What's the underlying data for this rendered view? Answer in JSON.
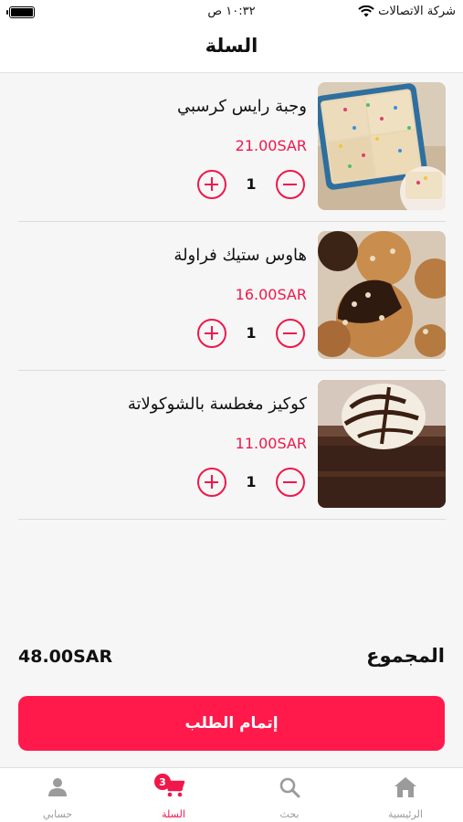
{
  "status_bar": {
    "time": "١٠:٣٢ ص",
    "carrier": "شركة الاتصالات"
  },
  "header": {
    "title": "السلة"
  },
  "cart": {
    "items": [
      {
        "name": "وجبة رايس كرسبي",
        "price": "21.00SAR",
        "quantity": "1"
      },
      {
        "name": "هاوس ستيك  فراولة",
        "price": "16.00SAR",
        "quantity": "1"
      },
      {
        "name": "كوكيز مغطسة بالشوكولاتة",
        "price": "11.00SAR",
        "quantity": "1"
      }
    ]
  },
  "summary": {
    "total_label": "المجموع",
    "total_value": "48.00SAR"
  },
  "checkout": {
    "label": "إتمام الطلب"
  },
  "tab_bar": {
    "tabs": [
      {
        "label": "حسابي",
        "icon": "person-icon"
      },
      {
        "label": "السلة",
        "icon": "cart-icon",
        "badge": "3"
      },
      {
        "label": "بحث",
        "icon": "search-icon"
      },
      {
        "label": "الرئيسية",
        "icon": "home-icon"
      }
    ]
  },
  "colors": {
    "accent": "#f0174a",
    "button": "#ff1a4b"
  }
}
